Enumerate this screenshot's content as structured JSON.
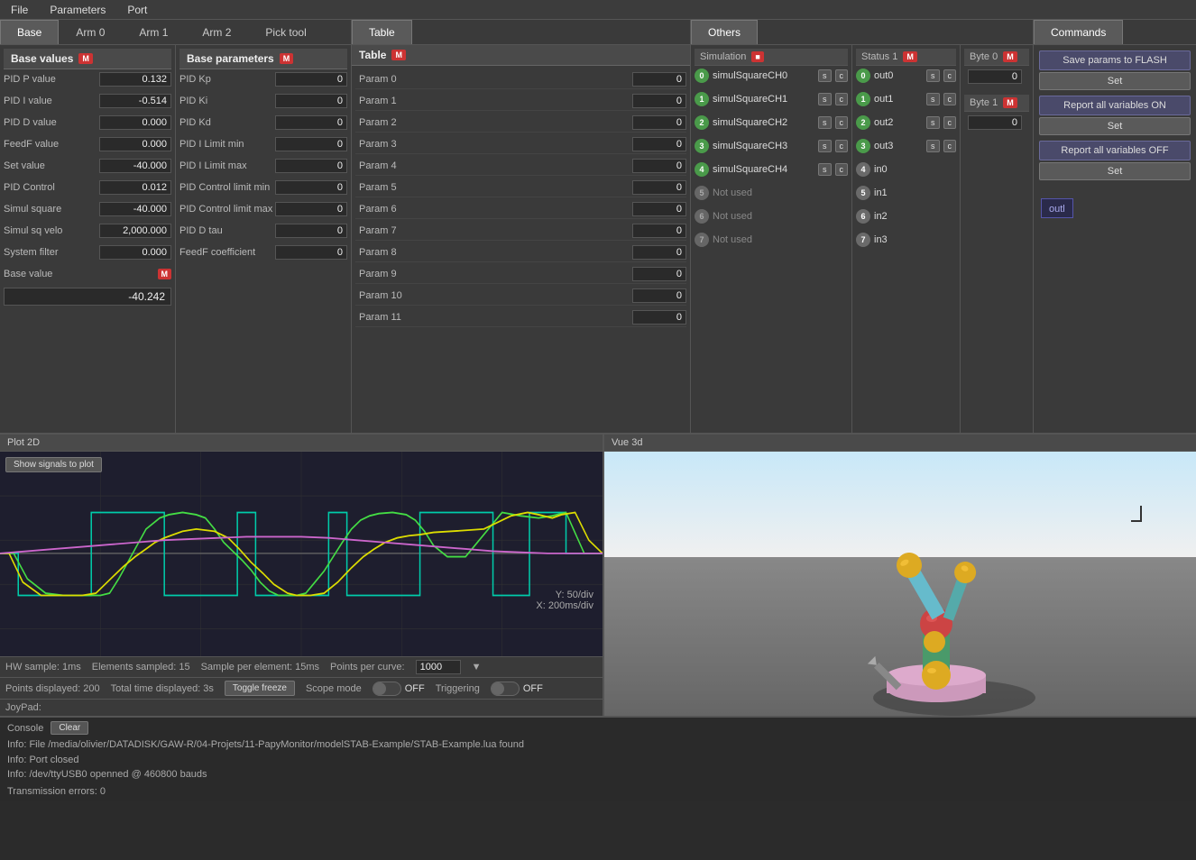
{
  "menubar": {
    "items": [
      "File",
      "Parameters",
      "Port"
    ]
  },
  "tabs": {
    "main": [
      "Base",
      "Arm 0",
      "Arm 1",
      "Arm 2",
      "Pick tool"
    ],
    "active": "Base",
    "table": "Table",
    "others": "Others",
    "commands": "Commands"
  },
  "base_panel": {
    "title": "Base values",
    "badge": "M",
    "fields": [
      {
        "label": "PID P value",
        "value": "0.132"
      },
      {
        "label": "PID I value",
        "value": "-0.514"
      },
      {
        "label": "PID D value",
        "value": "0.000"
      },
      {
        "label": "FeedF value",
        "value": "0.000"
      },
      {
        "label": "Set  value",
        "value": "-40.000"
      },
      {
        "label": "PID Control",
        "value": "0.012"
      },
      {
        "label": "Simul square",
        "value": "-40.000"
      },
      {
        "label": "Simul sq velo",
        "value": "2,000.000"
      },
      {
        "label": "System filter",
        "value": "0.000"
      },
      {
        "label": "Base value",
        "badge": "M",
        "value": ""
      }
    ],
    "large_value": "-40.242"
  },
  "base_params": {
    "title": "Base parameters",
    "badge": "M",
    "fields": [
      {
        "label": "PID Kp",
        "value": "0"
      },
      {
        "label": "PID Ki",
        "value": "0"
      },
      {
        "label": "PID Kd",
        "value": "0"
      },
      {
        "label": "PID I Limit min",
        "value": "0"
      },
      {
        "label": "PID I Limit max",
        "value": "0"
      },
      {
        "label": "PID Control limit min",
        "value": "0"
      },
      {
        "label": "PID Control limit max",
        "value": "0"
      },
      {
        "label": "PID D tau",
        "value": "0"
      },
      {
        "label": "FeedF coefficient",
        "value": "0"
      }
    ]
  },
  "table_panel": {
    "title": "Table",
    "badge": "M",
    "params": [
      {
        "label": "Param 0",
        "value": "0"
      },
      {
        "label": "Param 1",
        "value": "0"
      },
      {
        "label": "Param 2",
        "value": "0"
      },
      {
        "label": "Param 3",
        "value": "0"
      },
      {
        "label": "Param 4",
        "value": "0"
      },
      {
        "label": "Param 5",
        "value": "0"
      },
      {
        "label": "Param 6",
        "value": "0"
      },
      {
        "label": "Param 7",
        "value": "0"
      },
      {
        "label": "Param 8",
        "value": "0"
      },
      {
        "label": "Param 9",
        "value": "0"
      },
      {
        "label": "Param 10",
        "value": "0"
      },
      {
        "label": "Param 11",
        "value": "0"
      }
    ]
  },
  "others_panel": {
    "title": "Others",
    "simulation": {
      "title": "Simulation",
      "badge": "red",
      "items": [
        {
          "num": "0",
          "label": "simulSquareCH0",
          "color": "green"
        },
        {
          "num": "1",
          "label": "simulSquareCH1",
          "color": "green"
        },
        {
          "num": "2",
          "label": "simulSquareCH2",
          "color": "green"
        },
        {
          "num": "3",
          "label": "simulSquareCH3",
          "color": "green"
        },
        {
          "num": "4",
          "label": "simulSquareCH4",
          "color": "green"
        },
        {
          "num": "5",
          "label": "Not used",
          "color": "gray"
        },
        {
          "num": "6",
          "label": "Not used",
          "color": "gray"
        },
        {
          "num": "7",
          "label": "Not used",
          "color": "gray"
        }
      ]
    },
    "status1": {
      "title": "Status 1",
      "badge": "M",
      "items": [
        {
          "num": "0",
          "label": "out0"
        },
        {
          "num": "1",
          "label": "out1"
        },
        {
          "num": "2",
          "label": "out2"
        },
        {
          "num": "3",
          "label": "out3"
        },
        {
          "num": "4",
          "label": "in0"
        },
        {
          "num": "5",
          "label": "in1"
        },
        {
          "num": "6",
          "label": "in2"
        },
        {
          "num": "7",
          "label": "in3"
        }
      ]
    },
    "byte0": {
      "title": "Byte 0",
      "badge": "M",
      "value": "0"
    },
    "byte1": {
      "title": "Byte 1",
      "badge": "M",
      "value": "0"
    }
  },
  "commands_panel": {
    "title": "Commands",
    "buttons": [
      {
        "label": "Save params to FLASH",
        "type": "main"
      },
      {
        "label": "Set",
        "type": "set"
      },
      {
        "label": "Report all variables ON",
        "type": "main"
      },
      {
        "label": "Set",
        "type": "set"
      },
      {
        "label": "Report all variables OFF",
        "type": "main"
      },
      {
        "label": "Set",
        "type": "set"
      }
    ]
  },
  "plot2d": {
    "title": "Plot 2D",
    "show_signals_btn": "Show signals to plot",
    "overlay": {
      "y_label": "Y: 50/div",
      "x_label": "X: 200ms/div"
    },
    "outl_label": "outl",
    "controls": {
      "hw_sample": "HW sample: 1ms",
      "elements": "Elements sampled: 15",
      "sample_per": "Sample per element: 15ms",
      "points_per": "Points per curve:",
      "points_value": "1000",
      "points_displayed": "Points displayed: 200",
      "total_time": "Total time displayed: 3s",
      "toggle_freeze": "Toggle freeze",
      "scope_mode": "Scope mode",
      "scope_off": "OFF",
      "triggering": "Triggering",
      "trig_off": "OFF"
    }
  },
  "vue3d": {
    "title": "Vue 3d"
  },
  "console": {
    "label": "Console",
    "clear_btn": "Clear",
    "lines": [
      "Info: File /media/olivier/DATADISK/GAW-R/04-Projets/11-PapyMonitor/modelSTAB-Example/STAB-Example.lua found",
      "Info: Port closed",
      "Info: /dev/ttyUSB0 openned @ 460800 bauds"
    ],
    "transmission": "Transmission errors: 0"
  }
}
